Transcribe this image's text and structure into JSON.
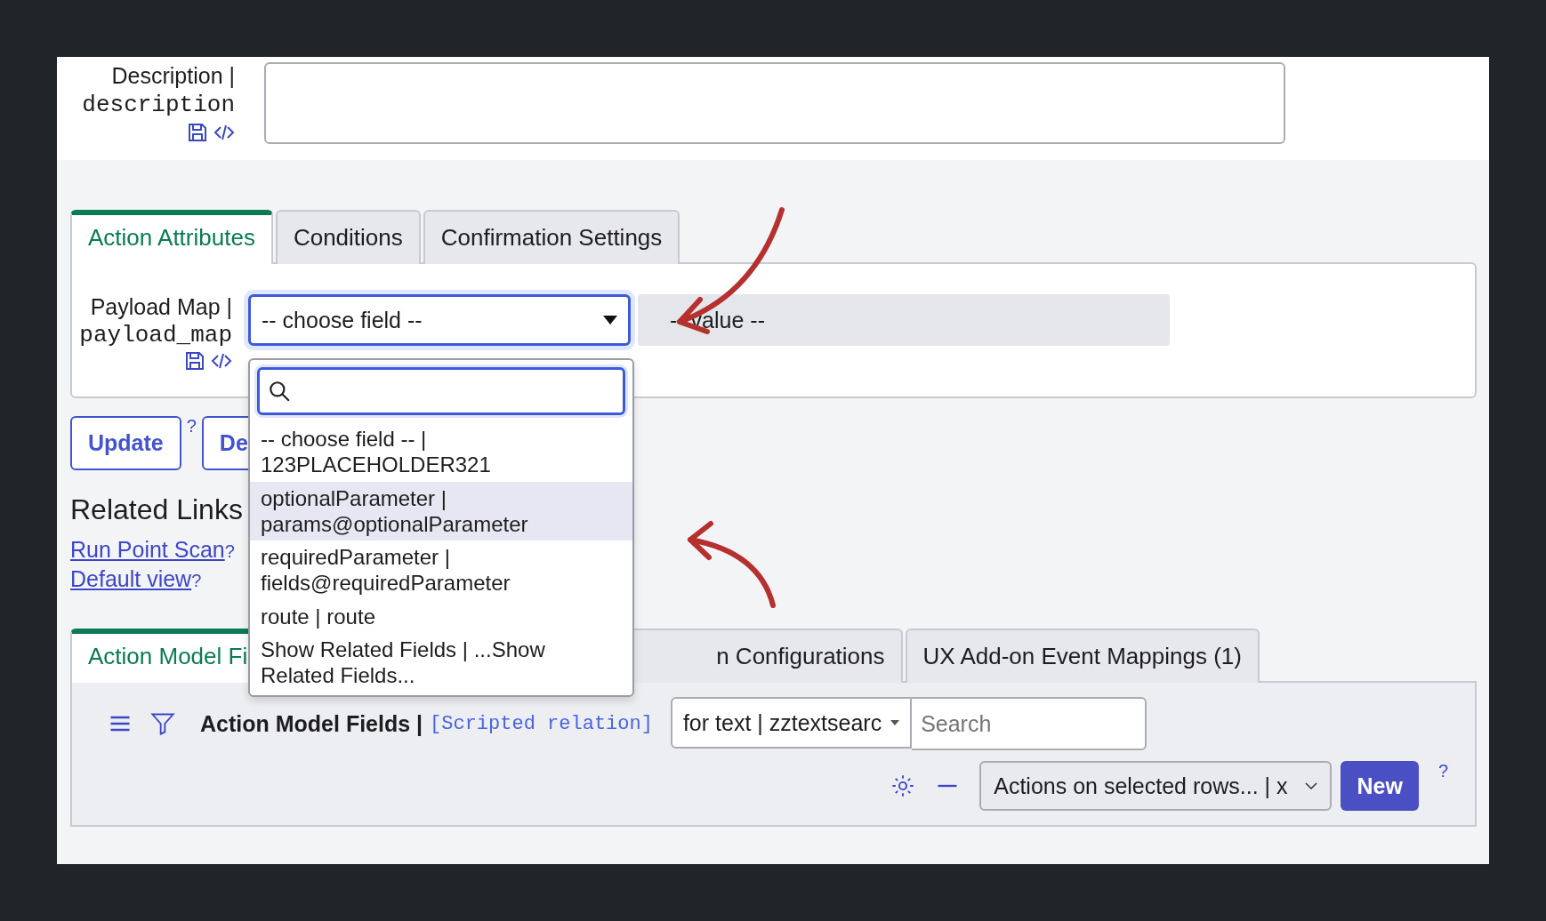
{
  "description_field": {
    "label": "Description |",
    "name": "description"
  },
  "tabs": [
    {
      "label": "Action Attributes",
      "selected": true
    },
    {
      "label": "Conditions",
      "selected": false
    },
    {
      "label": "Confirmation Settings",
      "selected": false
    }
  ],
  "payload_map": {
    "label": "Payload Map |",
    "name": "payload_map",
    "select": {
      "value": "-- choose field --",
      "expanded": true
    },
    "value_field": {
      "placeholder": "-- value --"
    },
    "options": [
      {
        "label": "-- choose field -- | 123PLACEHOLDER321",
        "selected": false
      },
      {
        "label": "optionalParameter | params@optionalParameter",
        "selected": true
      },
      {
        "label": "requiredParameter | fields@requiredParameter",
        "selected": false
      },
      {
        "label": "route | route",
        "selected": false
      },
      {
        "label": "Show Related Fields | ...Show Related Fields...",
        "selected": false
      }
    ]
  },
  "buttons": [
    {
      "label": "Update",
      "help": "?"
    },
    {
      "label": "De"
    }
  ],
  "related_links": {
    "title": "Related Links",
    "links": [
      {
        "label": "Run Point Scan",
        "help": "?"
      },
      {
        "label": "Default view",
        "help": "?"
      }
    ]
  },
  "lower_tabs": [
    {
      "label": "Action Model Fi",
      "selected": true
    },
    {
      "label": "n Configurations",
      "selected": false
    },
    {
      "label": "UX Add-on Event Mappings (1)",
      "selected": false
    }
  ],
  "list": {
    "title": "Action Model Fields |",
    "subtitle": "[Scripted relation]",
    "search_column": "for text | zztextsearc",
    "search": {
      "placeholder": "Search"
    },
    "actions_select": "Actions on selected rows... | x",
    "new_button": "New",
    "help": "?"
  }
}
